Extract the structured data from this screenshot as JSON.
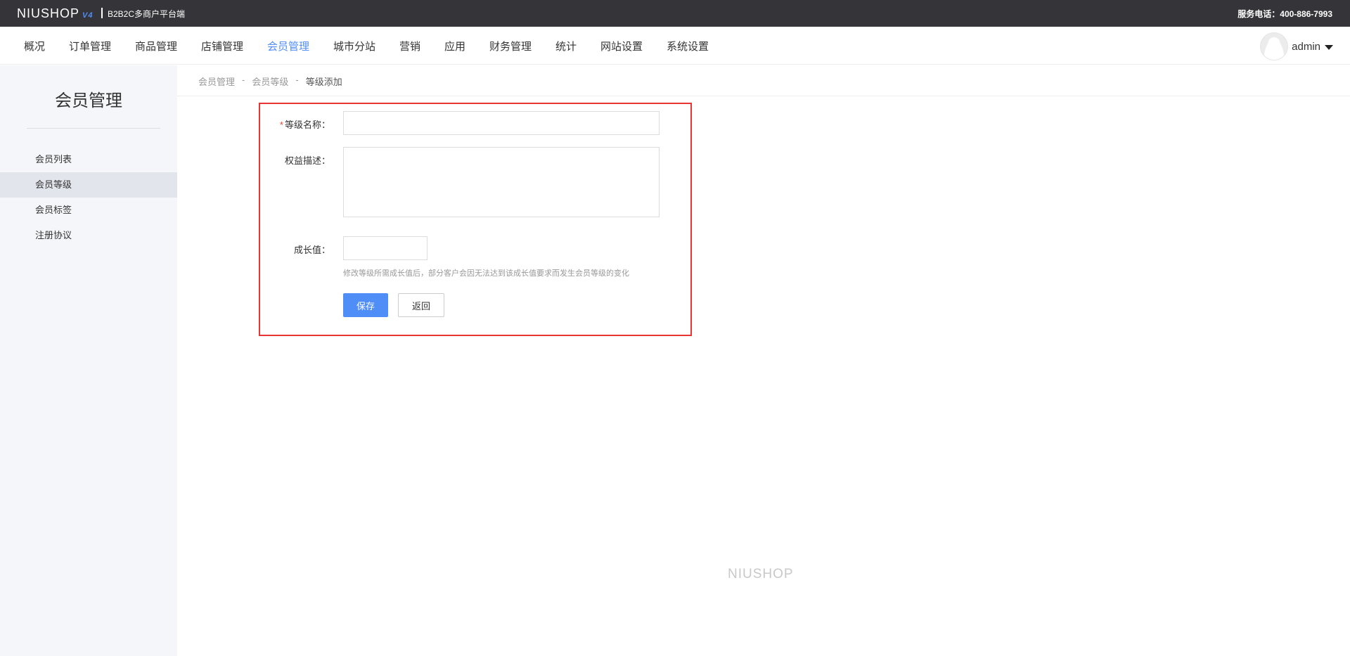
{
  "topbar": {
    "logo": "NIUSHOP",
    "logo_version": "V4",
    "platform": "B2B2C多商户平台端",
    "service": "服务电话：400-886-7993"
  },
  "nav": {
    "items": [
      {
        "label": "概况"
      },
      {
        "label": "订单管理"
      },
      {
        "label": "商品管理"
      },
      {
        "label": "店铺管理"
      },
      {
        "label": "会员管理",
        "active": true
      },
      {
        "label": "城市分站"
      },
      {
        "label": "营销"
      },
      {
        "label": "应用"
      },
      {
        "label": "财务管理"
      },
      {
        "label": "统计"
      },
      {
        "label": "网站设置"
      },
      {
        "label": "系统设置"
      }
    ],
    "active_color": "#4f8df7",
    "username": "admin"
  },
  "sidebar": {
    "title": "会员管理",
    "items": [
      {
        "label": "会员列表"
      },
      {
        "label": "会员等级",
        "active": true
      },
      {
        "label": "会员标签"
      },
      {
        "label": "注册协议"
      }
    ]
  },
  "breadcrumb": {
    "items": [
      "会员管理",
      "会员等级",
      "等级添加"
    ],
    "separator": "-"
  },
  "form": {
    "name_label": "等级名称：",
    "name_required_mark": "*",
    "name_value": "",
    "desc_label": "权益描述：",
    "desc_value": "",
    "growth_label": "成长值：",
    "growth_value": "",
    "growth_hint": "修改等级所需成长值后，部分客户会因无法达到该成长值要求而发生会员等级的变化",
    "save_label": "保存",
    "back_label": "返回",
    "highlight_color": "#e93434"
  },
  "footer": {
    "logo": "NIUSHOP"
  }
}
